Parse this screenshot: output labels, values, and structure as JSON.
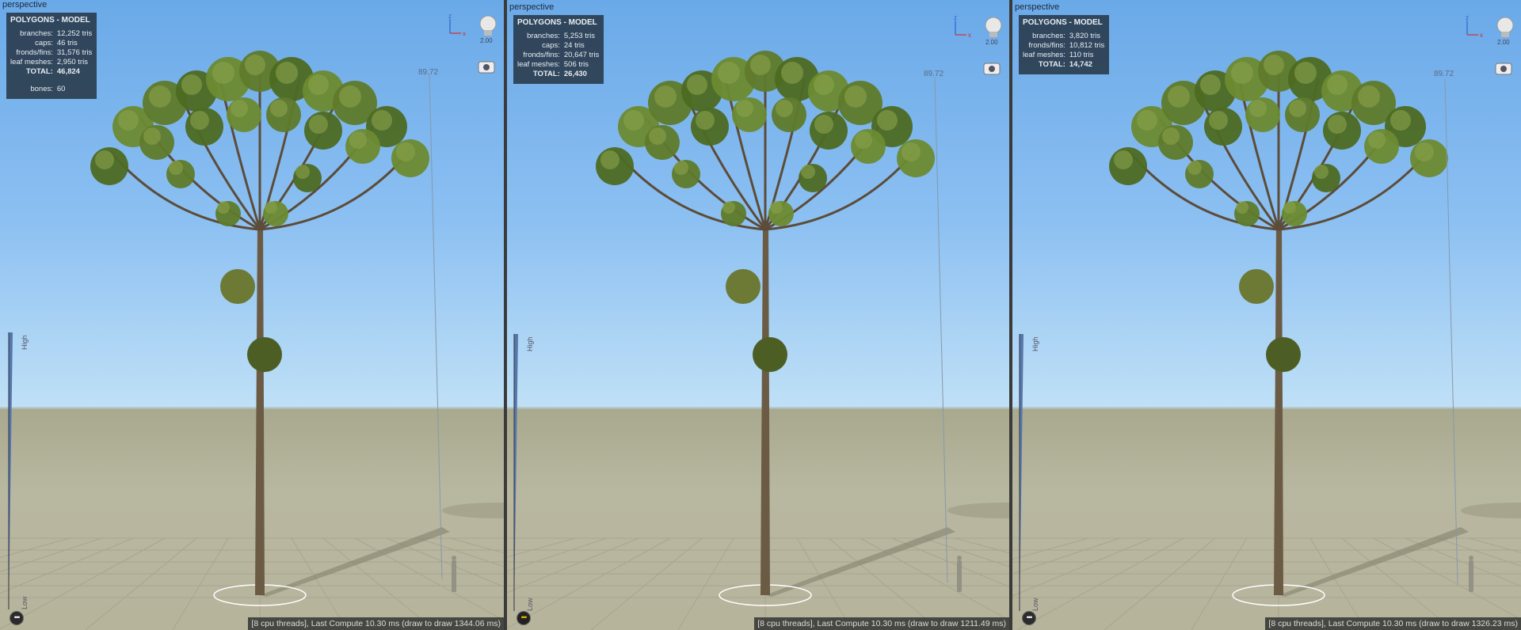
{
  "viewports": [
    {
      "title": "perspective",
      "stats_title": "POLYGONS - MODEL",
      "rows": [
        {
          "label": "branches:",
          "value": "12,252 tris"
        },
        {
          "label": "caps:",
          "value": "46 tris"
        },
        {
          "label": "fronds/fins:",
          "value": "31,576 tris"
        },
        {
          "label": "leaf meshes:",
          "value": "2,950 tris"
        },
        {
          "label": "TOTAL:",
          "value": "46,824"
        }
      ],
      "bones_label": "bones:",
      "bones_value": "60",
      "light_value": "2.00",
      "ruler_value": "89.72",
      "lod_high": "High",
      "lod_low": "Low",
      "status": "[8 cpu threads], Last Compute 10.30 ms (draw to draw 1344.06 ms)"
    },
    {
      "title": "perspective",
      "stats_title": "POLYGONS - MODEL",
      "rows": [
        {
          "label": "branches:",
          "value": "5,253 tris"
        },
        {
          "label": "caps:",
          "value": "24 tris"
        },
        {
          "label": "fronds/fins:",
          "value": "20,647 tris"
        },
        {
          "label": "leaf meshes:",
          "value": "506 tris"
        },
        {
          "label": "TOTAL:",
          "value": "26,430"
        }
      ],
      "light_value": "2.00",
      "ruler_value": "89.72",
      "lod_high": "High",
      "lod_low": "Low",
      "status": "[8 cpu threads], Last Compute 10.30 ms (draw to draw 1211.49 ms)"
    },
    {
      "title": "perspective",
      "stats_title": "POLYGONS - MODEL",
      "rows": [
        {
          "label": "branches:",
          "value": "3,820 tris"
        },
        {
          "label": "fronds/fins:",
          "value": "10,812 tris"
        },
        {
          "label": "leaf meshes:",
          "value": "110 tris"
        },
        {
          "label": "TOTAL:",
          "value": "14,742"
        }
      ],
      "light_value": "2.00",
      "ruler_value": "89.72",
      "lod_high": "High",
      "lod_low": "Low",
      "status": "[8 cpu threads], Last Compute 10.30 ms (draw to draw 1326.23 ms)"
    }
  ],
  "axis_labels": {
    "z": "z",
    "x": "x"
  },
  "colors": {
    "foliage": "#5f7a2a",
    "trunk": "#6b5b44",
    "stats_bg": "#283848"
  }
}
